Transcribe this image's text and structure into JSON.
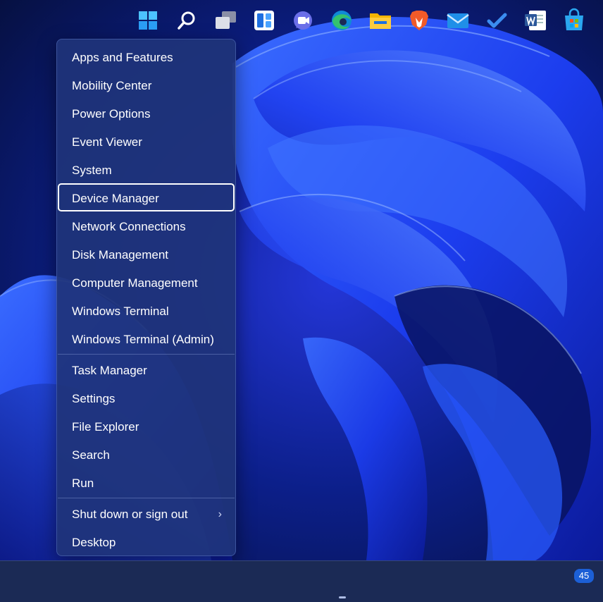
{
  "menu": {
    "items": [
      {
        "label": "Apps and Features"
      },
      {
        "label": "Mobility Center"
      },
      {
        "label": "Power Options"
      },
      {
        "label": "Event Viewer"
      },
      {
        "label": "System"
      },
      {
        "label": "Device Manager",
        "focused": true
      },
      {
        "label": "Network Connections"
      },
      {
        "label": "Disk Management"
      },
      {
        "label": "Computer Management"
      },
      {
        "label": "Windows Terminal"
      },
      {
        "label": "Windows Terminal (Admin)"
      },
      {
        "label": "Task Manager"
      },
      {
        "label": "Settings"
      },
      {
        "label": "File Explorer"
      },
      {
        "label": "Search"
      },
      {
        "label": "Run"
      },
      {
        "label": "Shut down or sign out",
        "submenu_indicator": "›"
      },
      {
        "label": "Desktop"
      }
    ]
  },
  "taskbar": {
    "icons": [
      "windows-start-icon",
      "search-icon",
      "task-view-icon",
      "widgets-icon",
      "chat-icon",
      "edge-icon",
      "file-explorer-icon",
      "brave-icon",
      "mail-icon",
      "todo-icon",
      "word-icon",
      "store-icon"
    ],
    "badge_count": "45",
    "active_app": "edge-icon"
  },
  "colors": {
    "menu_background": "#1f347a",
    "taskbar_background": "#1b2a55",
    "wallpaper_primary": "#1f3cff",
    "focus_ring": "#ffffff"
  }
}
